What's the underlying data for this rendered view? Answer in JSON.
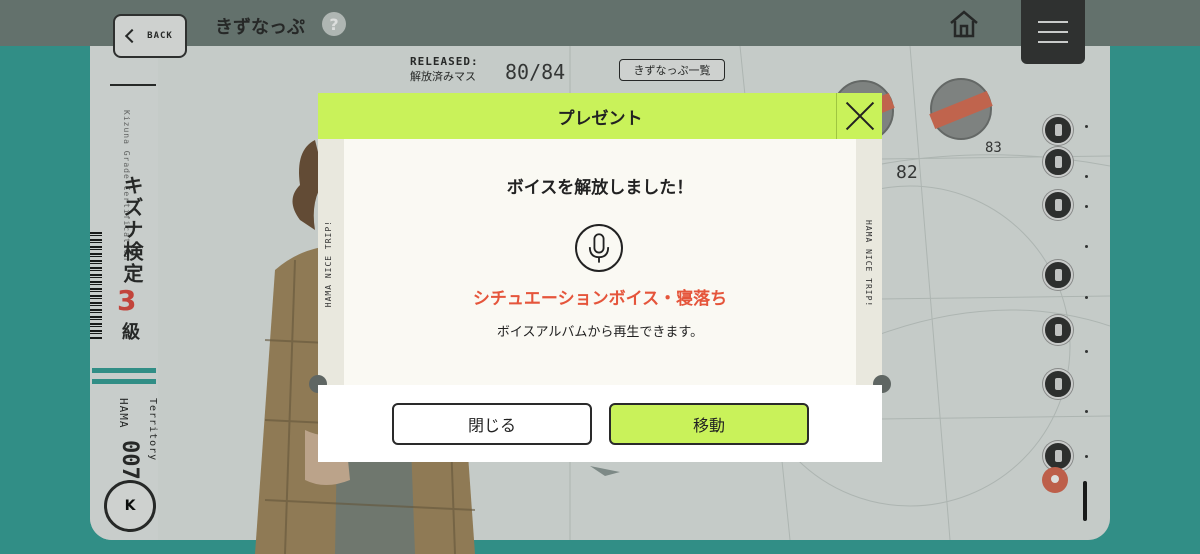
{
  "header": {
    "back_label": "BACK",
    "title": "きずなっぷ",
    "help_symbol": "?",
    "home_icon": "home-icon",
    "menu_icon": "hamburger-menu-icon"
  },
  "sidebar": {
    "subtitle_en": "Kizuna Grade Certification",
    "title_jp": "キズナ検定",
    "grade_number": "3",
    "grade_unit": "級",
    "territory_code": "HAMA",
    "territory_number": "007",
    "territory_label": "Territory",
    "emblem_label": "K"
  },
  "released": {
    "label_en": "RELEASED:",
    "label_jp": "解放済みマス",
    "count": "80/84",
    "list_button": "きずなっぷ一覧"
  },
  "map": {
    "node_labels": [
      "82",
      "83"
    ],
    "accent_color": "#dd6b50",
    "teal_color": "#2f9e95"
  },
  "modal": {
    "header_title": "プレゼント",
    "side_text": "HAMA NICE TRIP!",
    "message": "ボイスを解放しました！",
    "icon": "microphone-icon",
    "voice_name": "シチュエーションボイス・寝落ち",
    "note": "ボイスアルバムから再生できます。",
    "close_button": "閉じる",
    "move_button": "移動",
    "accent_color": "#c9f25a",
    "highlight_color": "#e5553b"
  }
}
